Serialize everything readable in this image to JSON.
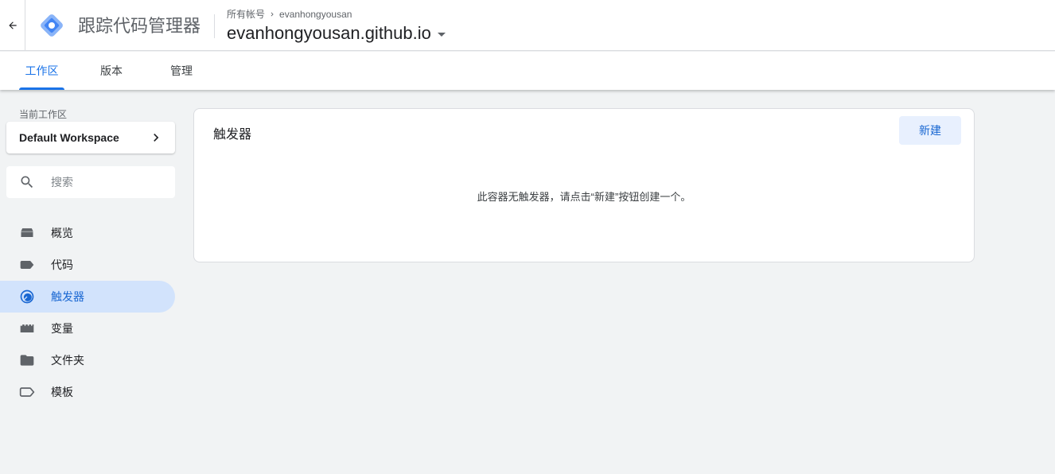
{
  "header": {
    "product_name": "跟踪代码管理器",
    "breadcrumb_account_label": "所有帐号",
    "breadcrumb_account_name": "evanhongyousan",
    "container_name": "evanhongyousan.github.io"
  },
  "tabs": [
    {
      "label": "工作区",
      "active": true
    },
    {
      "label": "版本",
      "active": false
    },
    {
      "label": "管理",
      "active": false
    }
  ],
  "sidebar": {
    "workspace_label": "当前工作区",
    "workspace_name": "Default Workspace",
    "search_placeholder": "搜索",
    "items": [
      {
        "label": "概览",
        "icon": "overview-icon"
      },
      {
        "label": "代码",
        "icon": "tag-icon"
      },
      {
        "label": "触发器",
        "icon": "trigger-icon",
        "active": true
      },
      {
        "label": "变量",
        "icon": "variable-icon"
      },
      {
        "label": "文件夹",
        "icon": "folder-icon"
      },
      {
        "label": "模板",
        "icon": "template-icon"
      }
    ]
  },
  "main": {
    "title": "触发器",
    "new_button": "新建",
    "empty_message": "此容器无触发器，请点击“新建”按钮创建一个。"
  },
  "colors": {
    "accent": "#1a73e8",
    "active_nav_bg": "#d2e3fc",
    "background": "#f1f3f4"
  }
}
